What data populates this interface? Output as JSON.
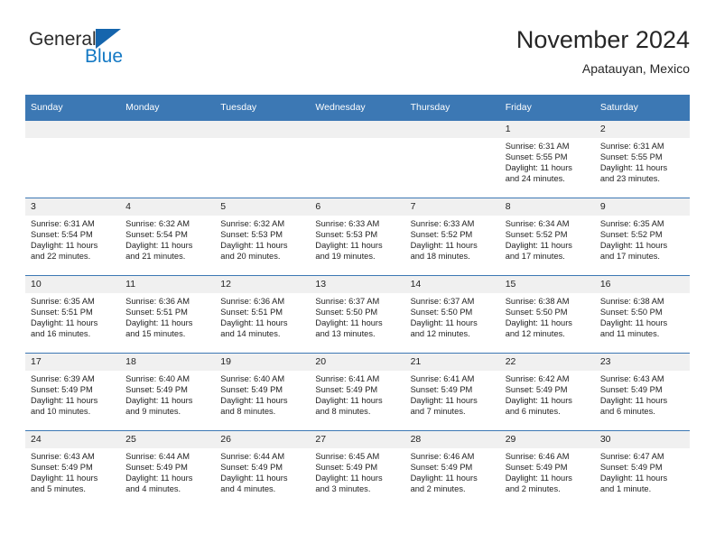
{
  "logo": {
    "primary_text": "General",
    "secondary_text": "Blue",
    "primary_color": "#2b2b2b",
    "secondary_color": "#1479c4",
    "triangle_color": "#1565ad"
  },
  "header": {
    "title": "November 2024",
    "subtitle": "Apatauyan, Mexico"
  },
  "theme": {
    "header_bar_color": "#3c78b4",
    "daynum_band_color": "#f0f0f0",
    "cell_border_color": "#3c78b4",
    "text_color": "#1f1f1f"
  },
  "weekdays": [
    "Sunday",
    "Monday",
    "Tuesday",
    "Wednesday",
    "Thursday",
    "Friday",
    "Saturday"
  ],
  "weeks": [
    [
      {
        "day": "",
        "empty": true,
        "sunrise": "",
        "sunset": "",
        "daylight_line1": "",
        "daylight_line2": ""
      },
      {
        "day": "",
        "empty": true,
        "sunrise": "",
        "sunset": "",
        "daylight_line1": "",
        "daylight_line2": ""
      },
      {
        "day": "",
        "empty": true,
        "sunrise": "",
        "sunset": "",
        "daylight_line1": "",
        "daylight_line2": ""
      },
      {
        "day": "",
        "empty": true,
        "sunrise": "",
        "sunset": "",
        "daylight_line1": "",
        "daylight_line2": ""
      },
      {
        "day": "",
        "empty": true,
        "sunrise": "",
        "sunset": "",
        "daylight_line1": "",
        "daylight_line2": ""
      },
      {
        "day": "1",
        "sunrise": "Sunrise: 6:31 AM",
        "sunset": "Sunset: 5:55 PM",
        "daylight_line1": "Daylight: 11 hours",
        "daylight_line2": "and 24 minutes."
      },
      {
        "day": "2",
        "sunrise": "Sunrise: 6:31 AM",
        "sunset": "Sunset: 5:55 PM",
        "daylight_line1": "Daylight: 11 hours",
        "daylight_line2": "and 23 minutes."
      }
    ],
    [
      {
        "day": "3",
        "sunrise": "Sunrise: 6:31 AM",
        "sunset": "Sunset: 5:54 PM",
        "daylight_line1": "Daylight: 11 hours",
        "daylight_line2": "and 22 minutes."
      },
      {
        "day": "4",
        "sunrise": "Sunrise: 6:32 AM",
        "sunset": "Sunset: 5:54 PM",
        "daylight_line1": "Daylight: 11 hours",
        "daylight_line2": "and 21 minutes."
      },
      {
        "day": "5",
        "sunrise": "Sunrise: 6:32 AM",
        "sunset": "Sunset: 5:53 PM",
        "daylight_line1": "Daylight: 11 hours",
        "daylight_line2": "and 20 minutes."
      },
      {
        "day": "6",
        "sunrise": "Sunrise: 6:33 AM",
        "sunset": "Sunset: 5:53 PM",
        "daylight_line1": "Daylight: 11 hours",
        "daylight_line2": "and 19 minutes."
      },
      {
        "day": "7",
        "sunrise": "Sunrise: 6:33 AM",
        "sunset": "Sunset: 5:52 PM",
        "daylight_line1": "Daylight: 11 hours",
        "daylight_line2": "and 18 minutes."
      },
      {
        "day": "8",
        "sunrise": "Sunrise: 6:34 AM",
        "sunset": "Sunset: 5:52 PM",
        "daylight_line1": "Daylight: 11 hours",
        "daylight_line2": "and 17 minutes."
      },
      {
        "day": "9",
        "sunrise": "Sunrise: 6:35 AM",
        "sunset": "Sunset: 5:52 PM",
        "daylight_line1": "Daylight: 11 hours",
        "daylight_line2": "and 17 minutes."
      }
    ],
    [
      {
        "day": "10",
        "sunrise": "Sunrise: 6:35 AM",
        "sunset": "Sunset: 5:51 PM",
        "daylight_line1": "Daylight: 11 hours",
        "daylight_line2": "and 16 minutes."
      },
      {
        "day": "11",
        "sunrise": "Sunrise: 6:36 AM",
        "sunset": "Sunset: 5:51 PM",
        "daylight_line1": "Daylight: 11 hours",
        "daylight_line2": "and 15 minutes."
      },
      {
        "day": "12",
        "sunrise": "Sunrise: 6:36 AM",
        "sunset": "Sunset: 5:51 PM",
        "daylight_line1": "Daylight: 11 hours",
        "daylight_line2": "and 14 minutes."
      },
      {
        "day": "13",
        "sunrise": "Sunrise: 6:37 AM",
        "sunset": "Sunset: 5:50 PM",
        "daylight_line1": "Daylight: 11 hours",
        "daylight_line2": "and 13 minutes."
      },
      {
        "day": "14",
        "sunrise": "Sunrise: 6:37 AM",
        "sunset": "Sunset: 5:50 PM",
        "daylight_line1": "Daylight: 11 hours",
        "daylight_line2": "and 12 minutes."
      },
      {
        "day": "15",
        "sunrise": "Sunrise: 6:38 AM",
        "sunset": "Sunset: 5:50 PM",
        "daylight_line1": "Daylight: 11 hours",
        "daylight_line2": "and 12 minutes."
      },
      {
        "day": "16",
        "sunrise": "Sunrise: 6:38 AM",
        "sunset": "Sunset: 5:50 PM",
        "daylight_line1": "Daylight: 11 hours",
        "daylight_line2": "and 11 minutes."
      }
    ],
    [
      {
        "day": "17",
        "sunrise": "Sunrise: 6:39 AM",
        "sunset": "Sunset: 5:49 PM",
        "daylight_line1": "Daylight: 11 hours",
        "daylight_line2": "and 10 minutes."
      },
      {
        "day": "18",
        "sunrise": "Sunrise: 6:40 AM",
        "sunset": "Sunset: 5:49 PM",
        "daylight_line1": "Daylight: 11 hours",
        "daylight_line2": "and 9 minutes."
      },
      {
        "day": "19",
        "sunrise": "Sunrise: 6:40 AM",
        "sunset": "Sunset: 5:49 PM",
        "daylight_line1": "Daylight: 11 hours",
        "daylight_line2": "and 8 minutes."
      },
      {
        "day": "20",
        "sunrise": "Sunrise: 6:41 AM",
        "sunset": "Sunset: 5:49 PM",
        "daylight_line1": "Daylight: 11 hours",
        "daylight_line2": "and 8 minutes."
      },
      {
        "day": "21",
        "sunrise": "Sunrise: 6:41 AM",
        "sunset": "Sunset: 5:49 PM",
        "daylight_line1": "Daylight: 11 hours",
        "daylight_line2": "and 7 minutes."
      },
      {
        "day": "22",
        "sunrise": "Sunrise: 6:42 AM",
        "sunset": "Sunset: 5:49 PM",
        "daylight_line1": "Daylight: 11 hours",
        "daylight_line2": "and 6 minutes."
      },
      {
        "day": "23",
        "sunrise": "Sunrise: 6:43 AM",
        "sunset": "Sunset: 5:49 PM",
        "daylight_line1": "Daylight: 11 hours",
        "daylight_line2": "and 6 minutes."
      }
    ],
    [
      {
        "day": "24",
        "sunrise": "Sunrise: 6:43 AM",
        "sunset": "Sunset: 5:49 PM",
        "daylight_line1": "Daylight: 11 hours",
        "daylight_line2": "and 5 minutes."
      },
      {
        "day": "25",
        "sunrise": "Sunrise: 6:44 AM",
        "sunset": "Sunset: 5:49 PM",
        "daylight_line1": "Daylight: 11 hours",
        "daylight_line2": "and 4 minutes."
      },
      {
        "day": "26",
        "sunrise": "Sunrise: 6:44 AM",
        "sunset": "Sunset: 5:49 PM",
        "daylight_line1": "Daylight: 11 hours",
        "daylight_line2": "and 4 minutes."
      },
      {
        "day": "27",
        "sunrise": "Sunrise: 6:45 AM",
        "sunset": "Sunset: 5:49 PM",
        "daylight_line1": "Daylight: 11 hours",
        "daylight_line2": "and 3 minutes."
      },
      {
        "day": "28",
        "sunrise": "Sunrise: 6:46 AM",
        "sunset": "Sunset: 5:49 PM",
        "daylight_line1": "Daylight: 11 hours",
        "daylight_line2": "and 2 minutes."
      },
      {
        "day": "29",
        "sunrise": "Sunrise: 6:46 AM",
        "sunset": "Sunset: 5:49 PM",
        "daylight_line1": "Daylight: 11 hours",
        "daylight_line2": "and 2 minutes."
      },
      {
        "day": "30",
        "sunrise": "Sunrise: 6:47 AM",
        "sunset": "Sunset: 5:49 PM",
        "daylight_line1": "Daylight: 11 hours",
        "daylight_line2": "and 1 minute."
      }
    ]
  ]
}
